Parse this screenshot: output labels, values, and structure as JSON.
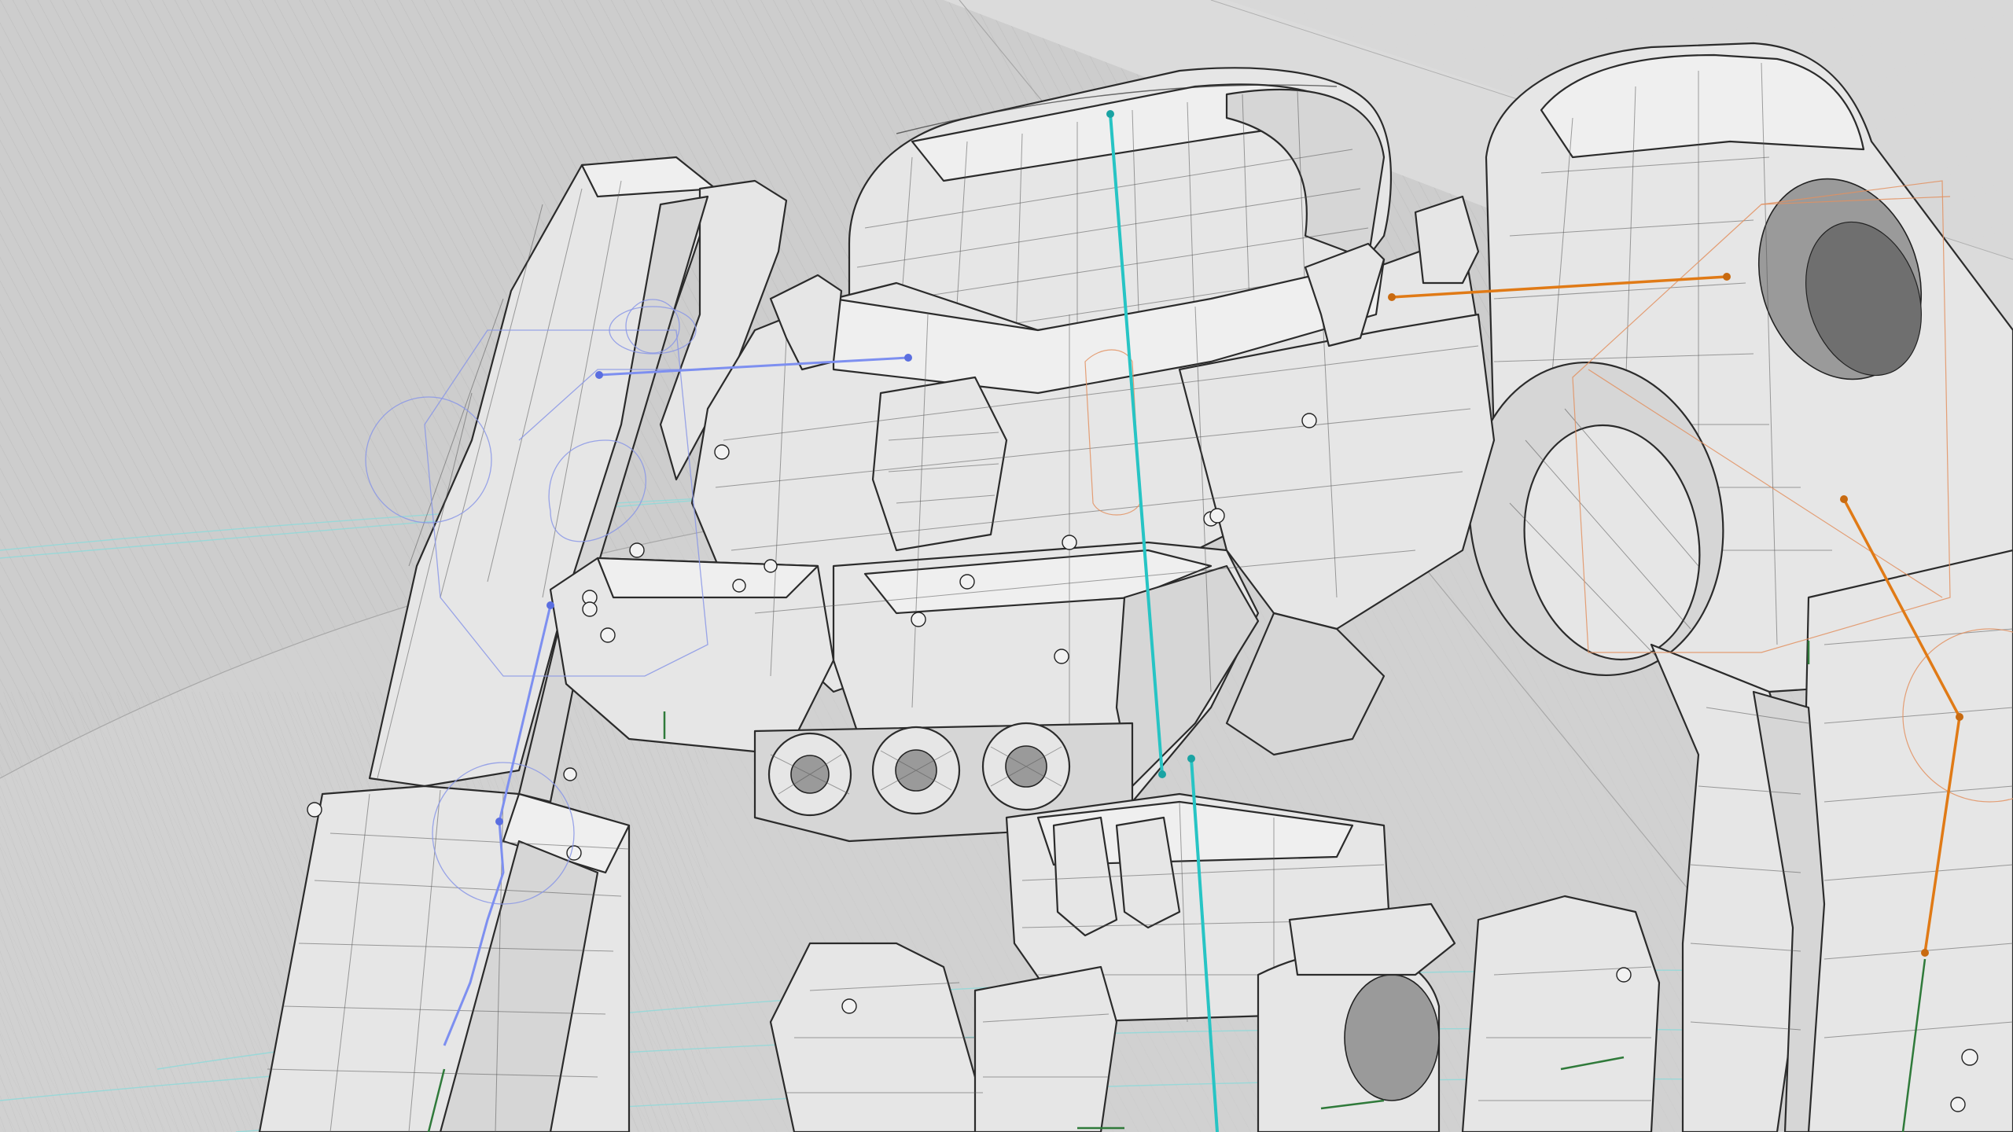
{
  "viewport": {
    "mode": "wireframe-on-shaded",
    "background_color": "#d2d2d2",
    "mesh_color": "#e6e6e6",
    "edge_color": "#2b2b2b"
  },
  "rig": {
    "bone_colors": {
      "spine": "#27c4c4",
      "right_arm": "#e07a16",
      "left_arm": "#7d8ff0",
      "helper": "#2f7a3a"
    },
    "guide_colors": {
      "ground_rings": "#8fd9d9",
      "left_controls": "#8a96e6",
      "right_controls": "#e29060"
    }
  },
  "model": {
    "subject": "mech-robot-torso",
    "parts": [
      "head",
      "chest-armor",
      "left-shoulder",
      "right-shoulder",
      "left-arm",
      "right-arm",
      "exhaust-barrels",
      "pelvis",
      "legs"
    ]
  }
}
